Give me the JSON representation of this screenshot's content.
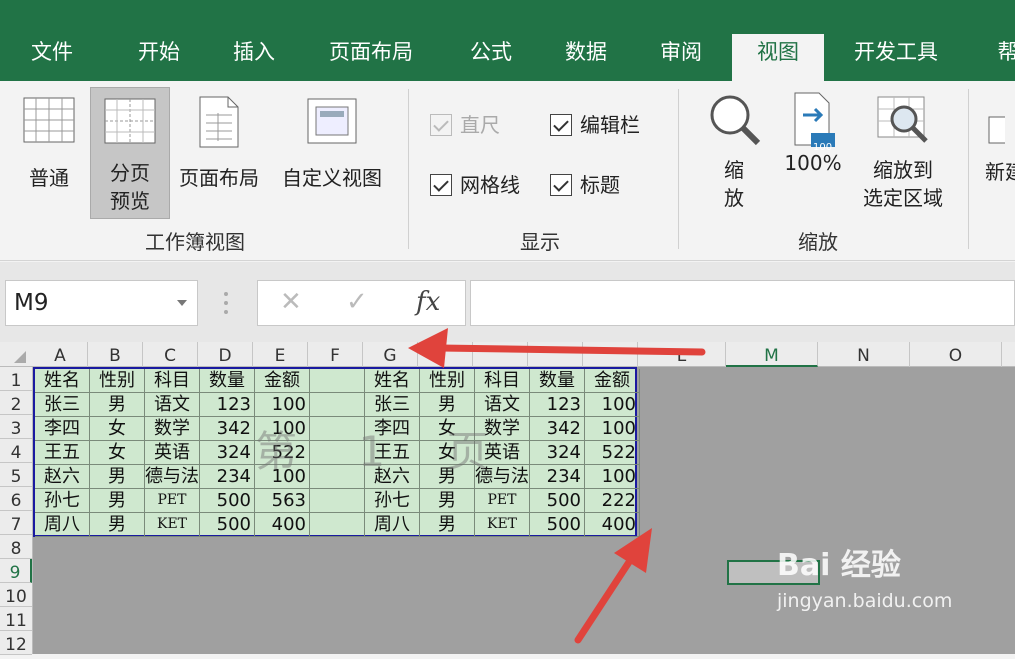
{
  "tabs": [
    "文件",
    "开始",
    "插入",
    "页面布局",
    "公式",
    "数据",
    "审阅",
    "视图",
    "开发工具",
    "帮"
  ],
  "active_tab": "视图",
  "ribbon": {
    "workbook_views": {
      "normal": "普通",
      "page_break_line1": "分页",
      "page_break_line2": "预览",
      "page_layout": "页面布局",
      "custom_views": "自定义视图",
      "group_label": "工作簿视图"
    },
    "show": {
      "ruler": "直尺",
      "formula_bar": "编辑栏",
      "gridlines": "网格线",
      "headings": "标题",
      "group_label": "显示"
    },
    "zoom": {
      "zoom_line1": "缩",
      "zoom_line2": "放",
      "zoom100": "100%",
      "zoom100_icon_text": "100",
      "zoom_sel_line1": "缩放到",
      "zoom_sel_line2": "选定区域",
      "group_label": "缩放"
    },
    "new_window": "新建"
  },
  "name_box": "M9",
  "formula_buttons": {
    "cancel": "✕",
    "enter": "✓",
    "fx": "fx"
  },
  "columns": [
    "A",
    "B",
    "C",
    "D",
    "E",
    "F",
    "G",
    "",
    "",
    "",
    "",
    "L",
    "M",
    "N",
    "O"
  ],
  "rows": [
    "1",
    "2",
    "3",
    "4",
    "5",
    "6",
    "7",
    "8",
    "9",
    "10",
    "11",
    "12"
  ],
  "table1": {
    "headers": [
      "姓名",
      "性别",
      "科目",
      "数量",
      "金额"
    ],
    "rows": [
      [
        "张三",
        "男",
        "语文",
        "123",
        "100"
      ],
      [
        "李四",
        "女",
        "数学",
        "342",
        "100"
      ],
      [
        "王五",
        "女",
        "英语",
        "324",
        "522"
      ],
      [
        "赵六",
        "男",
        "德与法",
        "234",
        "100"
      ],
      [
        "孙七",
        "男",
        "PET",
        "500",
        "563"
      ],
      [
        "周八",
        "男",
        "KET",
        "500",
        "400"
      ]
    ]
  },
  "table2": {
    "headers": [
      "姓名",
      "性别",
      "科目",
      "数量",
      "金额"
    ],
    "rows": [
      [
        "张三",
        "男",
        "语文",
        "123",
        "100"
      ],
      [
        "李四",
        "女",
        "数学",
        "342",
        "100"
      ],
      [
        "王五",
        "女",
        "英语",
        "324",
        "522"
      ],
      [
        "赵六",
        "男",
        "德与法",
        "234",
        "100"
      ],
      [
        "孙七",
        "男",
        "PET",
        "500",
        "222"
      ],
      [
        "周八",
        "男",
        "KET",
        "500",
        "400"
      ]
    ]
  },
  "page_watermark": "第 1 页",
  "baidu_logo": "Bai  经验",
  "baidu_url": "jingyan.baidu.com",
  "colors": {
    "excel_green": "#217346",
    "print_area": "#cfe8cf",
    "page_border": "#1a1aa0",
    "arrow": "#e0433c"
  }
}
